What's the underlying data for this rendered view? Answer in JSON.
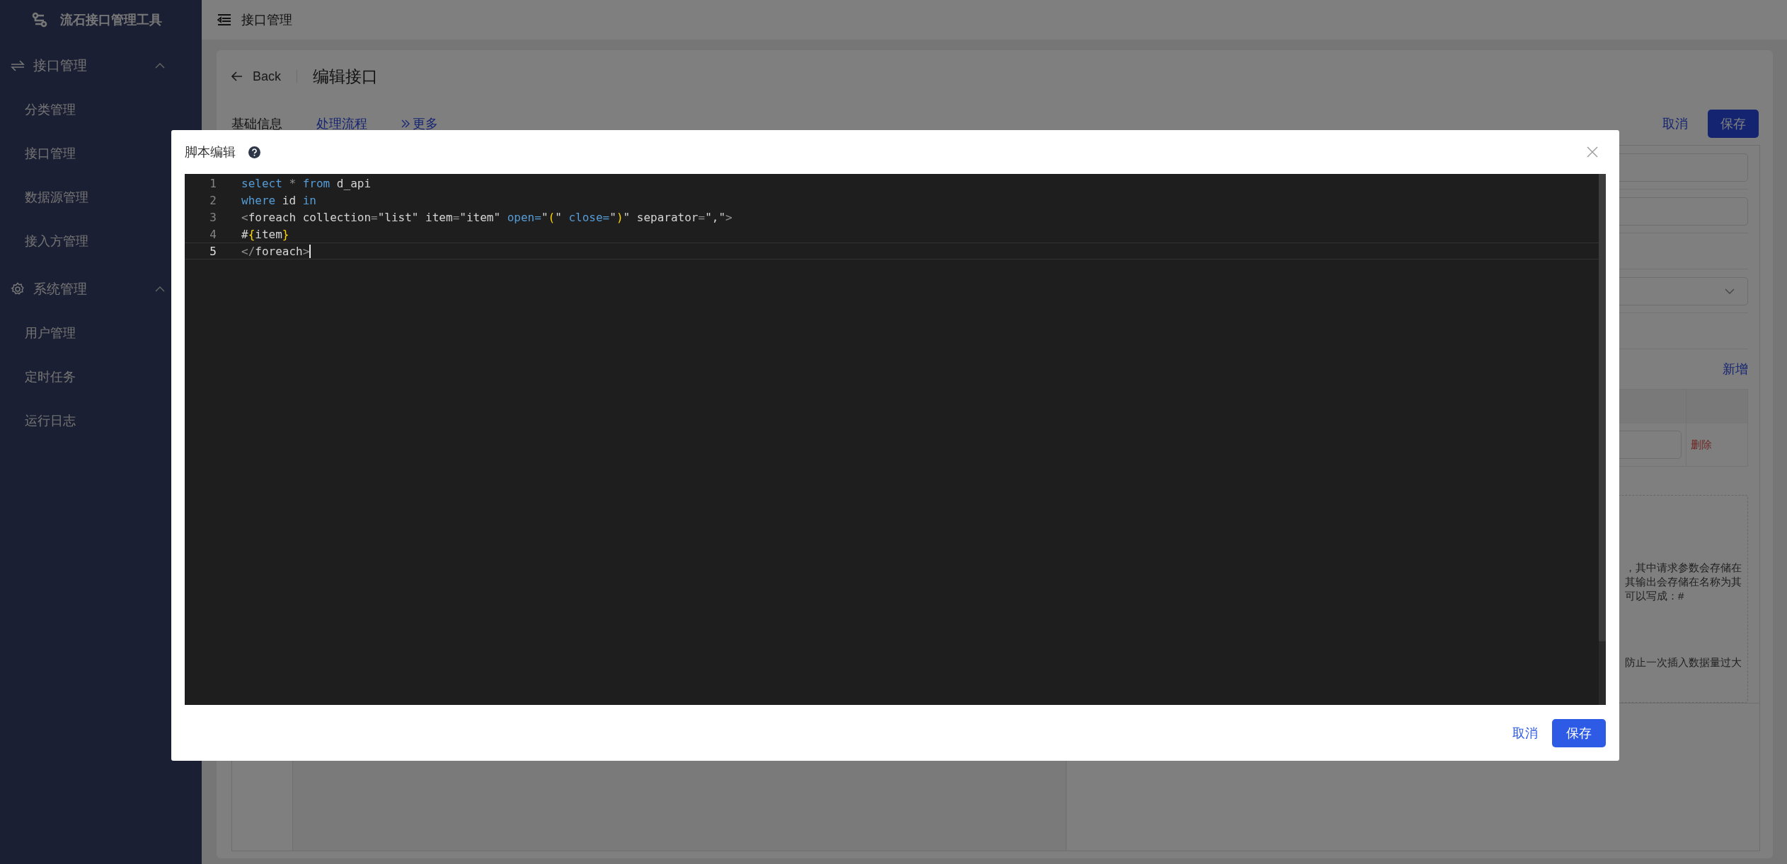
{
  "sidebar": {
    "app_title": "流石接口管理工具",
    "groups": [
      {
        "label": "接口管理",
        "kind": "exchange",
        "expanded": true,
        "children": [
          {
            "label": "分类管理"
          },
          {
            "label": "接口管理"
          },
          {
            "label": "数据源管理"
          },
          {
            "label": "接入方管理"
          }
        ]
      },
      {
        "label": "系统管理",
        "kind": "gear",
        "expanded": true,
        "children": [
          {
            "label": "用户管理"
          },
          {
            "label": "定时任务"
          },
          {
            "label": "运行日志"
          }
        ]
      }
    ]
  },
  "header": {
    "breadcrumb": "接口管理"
  },
  "page": {
    "back": "Back",
    "title": "编辑接口",
    "tabs": [
      {
        "label": "基础信息",
        "kind": "tab",
        "selected": true
      },
      {
        "label": "处理流程",
        "kind": "tab",
        "selected": false
      },
      {
        "label": "更多",
        "kind": "more",
        "selected": false
      }
    ],
    "cancel": "取消",
    "save": "保存",
    "add": "新增",
    "delete": "删除",
    "notes": [
      "，其中请求参数会存储在",
      "其输出会存储在名称为其",
      "可以写成：#",
      "防止一次插入数据量过大"
    ]
  },
  "dialog": {
    "title": "脚本编辑",
    "lines": [
      {
        "number": "1",
        "active": false,
        "tokens": [
          {
            "text": "select",
            "kind": "kw"
          },
          {
            "text": " * ",
            "kind": "punct"
          },
          {
            "text": "from",
            "kind": "kw"
          },
          {
            "text": " d_api",
            "kind": "text"
          }
        ]
      },
      {
        "number": "2",
        "active": false,
        "tokens": [
          {
            "text": "where",
            "kind": "kw"
          },
          {
            "text": " id ",
            "kind": "text"
          },
          {
            "text": "in",
            "kind": "kw"
          }
        ]
      },
      {
        "number": "3",
        "active": false,
        "tokens": [
          {
            "text": "<",
            "kind": "punct"
          },
          {
            "text": "foreach collection",
            "kind": "text"
          },
          {
            "text": "=",
            "kind": "punct"
          },
          {
            "text": "\"list\" item",
            "kind": "text"
          },
          {
            "text": "=",
            "kind": "punct"
          },
          {
            "text": "\"item\" ",
            "kind": "text"
          },
          {
            "text": "open=",
            "kind": "kw"
          },
          {
            "text": "\"",
            "kind": "text"
          },
          {
            "text": "(",
            "kind": "brace"
          },
          {
            "text": "\" ",
            "kind": "text"
          },
          {
            "text": "close=",
            "kind": "kw"
          },
          {
            "text": "\"",
            "kind": "text"
          },
          {
            "text": ")",
            "kind": "brace"
          },
          {
            "text": "\" separator",
            "kind": "text"
          },
          {
            "text": "=",
            "kind": "punct"
          },
          {
            "text": "\",\"",
            "kind": "text"
          },
          {
            "text": ">",
            "kind": "punct"
          }
        ]
      },
      {
        "number": "4",
        "active": false,
        "tokens": [
          {
            "text": "#",
            "kind": "text"
          },
          {
            "text": "{",
            "kind": "brace"
          },
          {
            "text": "item",
            "kind": "text"
          },
          {
            "text": "}",
            "kind": "brace"
          }
        ]
      },
      {
        "number": "5",
        "active": true,
        "tokens": [
          {
            "text": "</",
            "kind": "punct"
          },
          {
            "text": "foreach",
            "kind": "text"
          },
          {
            "text": ">",
            "kind": "punct"
          }
        ]
      }
    ],
    "cancel": "取消",
    "save": "保存"
  }
}
